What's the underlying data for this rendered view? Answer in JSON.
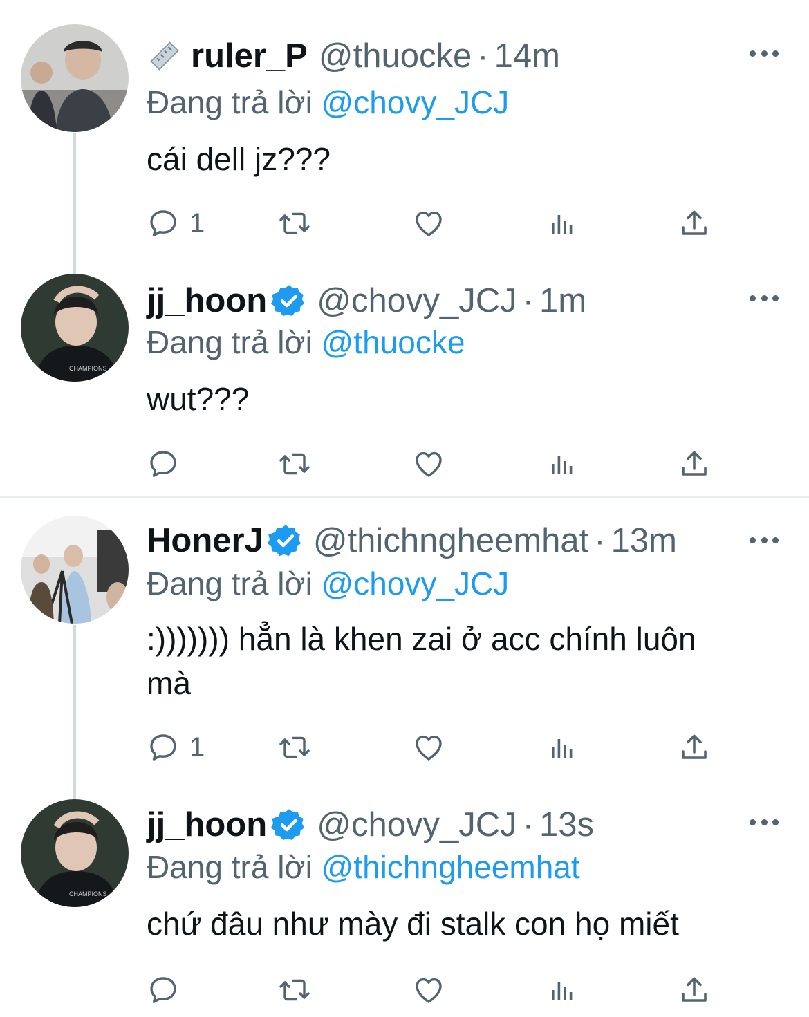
{
  "ui": {
    "reply_prefix": "Đang trả lời",
    "colors": {
      "accent": "#1d9bf0",
      "secondary_text": "#536471",
      "primary_text": "#0f1419"
    }
  },
  "tweets": [
    {
      "name": "ruler_P",
      "handle": "@thuocke",
      "time": "14m",
      "replying_to": "@chovy_JCJ",
      "text": "cái dell jz???",
      "reply_count": "1",
      "verified": false,
      "name_emoji": "straight-ruler-icon"
    },
    {
      "name": "jj_hoon",
      "handle": "@chovy_JCJ",
      "time": "1m",
      "replying_to": "@thuocke",
      "text": "wut???",
      "reply_count": "",
      "verified": true
    },
    {
      "name": "HonerJ",
      "handle": "@thichngheemhat",
      "time": "13m",
      "replying_to": "@chovy_JCJ",
      "text": ":))))))) hẳn là khen zai ở acc chính luôn mà",
      "reply_count": "1",
      "verified": true
    },
    {
      "name": "jj_hoon",
      "handle": "@chovy_JCJ",
      "time": "13s",
      "replying_to": "@thichngheemhat",
      "text": "chứ đâu như mày đi stalk con họ miết",
      "reply_count": "",
      "verified": true
    }
  ]
}
